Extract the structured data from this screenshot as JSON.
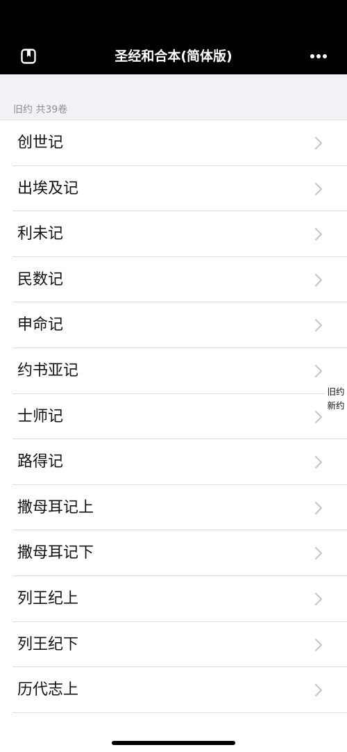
{
  "header": {
    "title": "圣经和合本(简体版)",
    "left_icon": "bookmark-icon",
    "right_icon": "more-icon"
  },
  "section": {
    "label": "旧约 共39卷"
  },
  "books": [
    {
      "label": "创世记"
    },
    {
      "label": "出埃及记"
    },
    {
      "label": "利未记"
    },
    {
      "label": "民数记"
    },
    {
      "label": "申命记"
    },
    {
      "label": "约书亚记"
    },
    {
      "label": "士师记"
    },
    {
      "label": "路得记"
    },
    {
      "label": "撒母耳记上"
    },
    {
      "label": "撒母耳记下"
    },
    {
      "label": "列王纪上"
    },
    {
      "label": "列王纪下"
    },
    {
      "label": "历代志上"
    }
  ],
  "index": [
    "旧约",
    "新约"
  ],
  "colors": {
    "topbar": "#000000",
    "section_bg": "#f2f2f7",
    "section_text": "#8e8e93",
    "chevron": "#c4c4c7"
  }
}
